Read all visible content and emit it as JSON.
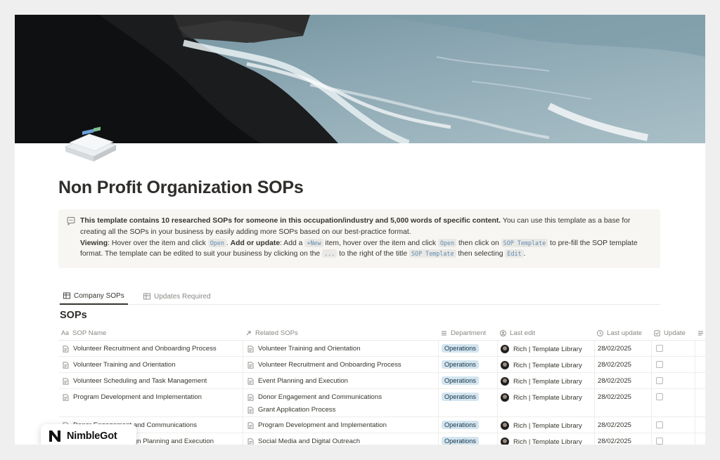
{
  "page": {
    "title": "Non Profit Organization SOPs"
  },
  "callout": {
    "icon": "speech-bubble-icon",
    "intro_bold": "This template contains 10 researched SOPs for someone in this occupation/industry and 5,000 words of specific content.",
    "intro_rest": " You can use this template as a base for creating all the SOPs in your business by easily adding more SOPs based on our best-practice format.",
    "viewing_label": "Viewing",
    "viewing_text_1": ": Hover over the item and click ",
    "code_open": "Open",
    "viewing_text_2": ". ",
    "add_label": "Add or update",
    "add_text_1": ": Add a ",
    "code_new": "+New",
    "add_text_2": " item, hover over the item and click ",
    "add_text_3": " then click on ",
    "code_sop_template": "SOP Template",
    "add_text_4": " to pre-fill the SOP template format. The template can be edited to suit your business by clicking on the ",
    "code_dots": "...",
    "add_text_5": " to the right of the title ",
    "add_text_6": " then selecting ",
    "code_edit": "Edit",
    "add_text_7": "."
  },
  "tabs": [
    {
      "label": "Company SOPs",
      "active": true
    },
    {
      "label": "Updates Required",
      "active": false
    }
  ],
  "database": {
    "title": "SOPs",
    "columns": {
      "name": "SOP Name",
      "related": "Related SOPs",
      "department": "Department",
      "last_edit": "Last edit",
      "last_update": "Last update",
      "update": "Update"
    },
    "rows": [
      {
        "name": "Volunteer Recruitment and Onboarding Process",
        "related": [
          "Volunteer Training and Orientation"
        ],
        "department": "Operations",
        "editor": "Rich | Template Library",
        "date": "28/02/2025",
        "update": false
      },
      {
        "name": "Volunteer Training and Orientation",
        "related": [
          "Volunteer Recruitment and Onboarding Process"
        ],
        "department": "Operations",
        "editor": "Rich | Template Library",
        "date": "28/02/2025",
        "update": false
      },
      {
        "name": "Volunteer Scheduling and Task Management",
        "related": [
          "Event Planning and Execution"
        ],
        "department": "Operations",
        "editor": "Rich | Template Library",
        "date": "28/02/2025",
        "update": false
      },
      {
        "name": "Program Development and Implementation",
        "related": [
          "Donor Engagement and Communications",
          "Grant Application Process"
        ],
        "department": "Operations",
        "editor": "Rich | Template Library",
        "date": "28/02/2025",
        "update": false
      },
      {
        "name": "Donor Engagement and Communications",
        "related": [
          "Program Development and Implementation"
        ],
        "department": "Operations",
        "editor": "Rich | Template Library",
        "date": "28/02/2025",
        "update": false
      },
      {
        "name": "Fundraising Campaign Planning and Execution",
        "related": [
          "Social Media and Digital Outreach"
        ],
        "department": "Operations",
        "editor": "Rich | Template Library",
        "date": "28/02/2025",
        "update": false
      }
    ]
  },
  "brand": {
    "name": "NimbleGot",
    "logo": "nimblegot-n-logo"
  },
  "colors": {
    "tag_bg": "#d3e5ef",
    "code_text": "#5f8bb0",
    "callout_bg": "#f7f6f3"
  }
}
